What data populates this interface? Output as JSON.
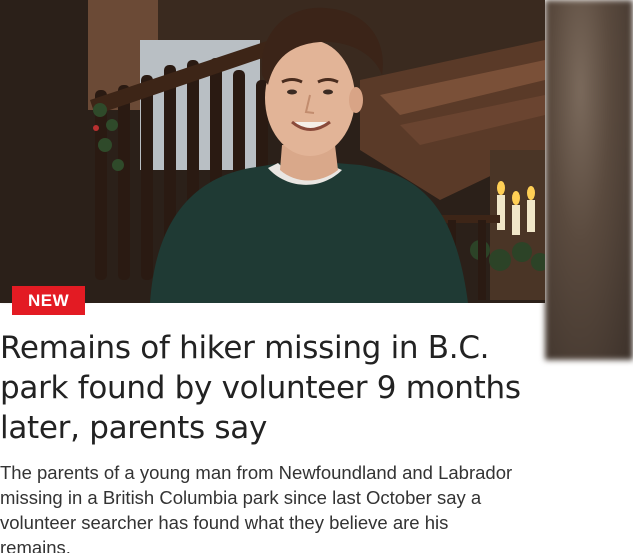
{
  "article": {
    "badge": "NEW",
    "headline": "Remains of hiker missing in B.C. park found by volunteer 9 months later, parents say",
    "summary": "The parents of a young man from Newfoundland and Labrador missing in a British Columbia park since last October say a volunteer searcher has found what they believe are his remains."
  },
  "colors": {
    "badge_bg": "#e31b23",
    "headline": "#222222",
    "summary": "#333333"
  }
}
